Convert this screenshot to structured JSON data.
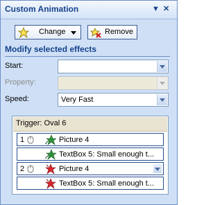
{
  "pane": {
    "title": "Custom Animation",
    "dropdown_icon": "chevron-down-icon",
    "close_icon": "close-icon"
  },
  "toolbar": {
    "change_label": "Change",
    "change_icon": "star-add-icon",
    "remove_label": "Remove",
    "remove_icon": "remove-effect-icon"
  },
  "modify": {
    "section_title": "Modify selected effects",
    "start_label": "Start:",
    "start_value": "",
    "property_label": "Property:",
    "property_value": "",
    "speed_label": "Speed:",
    "speed_value": "Very Fast"
  },
  "effects": {
    "trigger_label": "Trigger: Oval 6",
    "items": [
      {
        "number": "1",
        "has_mouse_icon": true,
        "icon": "entrance-star-icon",
        "label": "Picture 4",
        "selected": false,
        "show_arrow": false
      },
      {
        "number": "",
        "has_mouse_icon": false,
        "icon": "entrance-star-icon",
        "label": "TextBox 5: Small enough t...",
        "selected": false,
        "show_arrow": false
      },
      {
        "number": "2",
        "has_mouse_icon": true,
        "icon": "exit-star-icon",
        "label": "Picture 4",
        "selected": true,
        "show_arrow": true
      },
      {
        "number": "",
        "has_mouse_icon": false,
        "icon": "exit-star-icon",
        "label": "TextBox 5: Small enough t...",
        "selected": false,
        "show_arrow": false
      }
    ]
  },
  "colors": {
    "pane_bg": "#cfe0f6",
    "accent": "#15428b",
    "entrance_star": "#2f8f3c",
    "exit_star": "#d8262b"
  }
}
